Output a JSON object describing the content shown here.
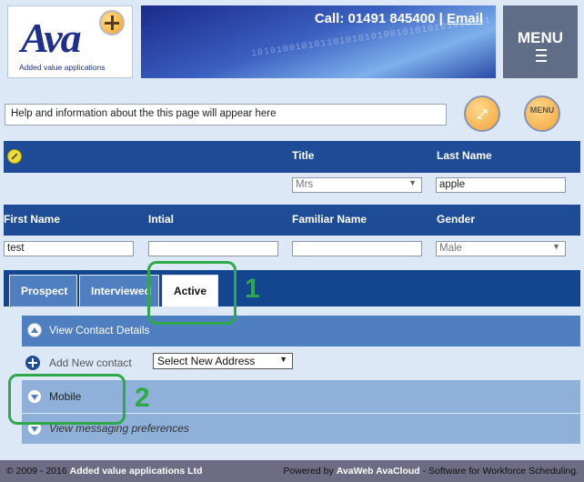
{
  "header": {
    "logo_text": "Ava",
    "logo_tagline": "Added value applications",
    "call_label": "Call: 01491 845400",
    "separator": "|",
    "email_link": "Email",
    "binary_decoration": "10101001010110101010100101010101010101",
    "menu_label": "MENU"
  },
  "help_text": "Help and information about the this page will appear here",
  "icons": {
    "expand_glyph": "⤢",
    "menu_round_label": "MENU"
  },
  "form": {
    "title_label": "Title",
    "last_name_label": "Last Name",
    "title_value": "Mrs",
    "last_name_value": "apple",
    "first_name_label": "First Name",
    "initial_label": "Intial",
    "familiar_name_label": "Familiar Name",
    "gender_label": "Gender",
    "first_name_value": "test",
    "initial_value": "",
    "familiar_name_value": "",
    "gender_value": "Male"
  },
  "tabs": [
    {
      "label": "Prospect",
      "active": false
    },
    {
      "label": "Interviewed",
      "active": false
    },
    {
      "label": "Active",
      "active": true
    }
  ],
  "sections": {
    "view_contact": "View Contact Details",
    "add_contact": "Add New contact",
    "address_select": "Select New Address",
    "mobile": "Mobile",
    "messaging": "View messaging preferences"
  },
  "annotations": {
    "one": "1",
    "two": "2",
    "color": "#2fa84a"
  },
  "footer": {
    "copyright": "© 2009 - 2016",
    "company": "Added value applications Ltd",
    "powered_by": "Powered by",
    "product": "AvaWeb AvaCloud",
    "tagline": " - Software for Workforce Scheduling."
  }
}
